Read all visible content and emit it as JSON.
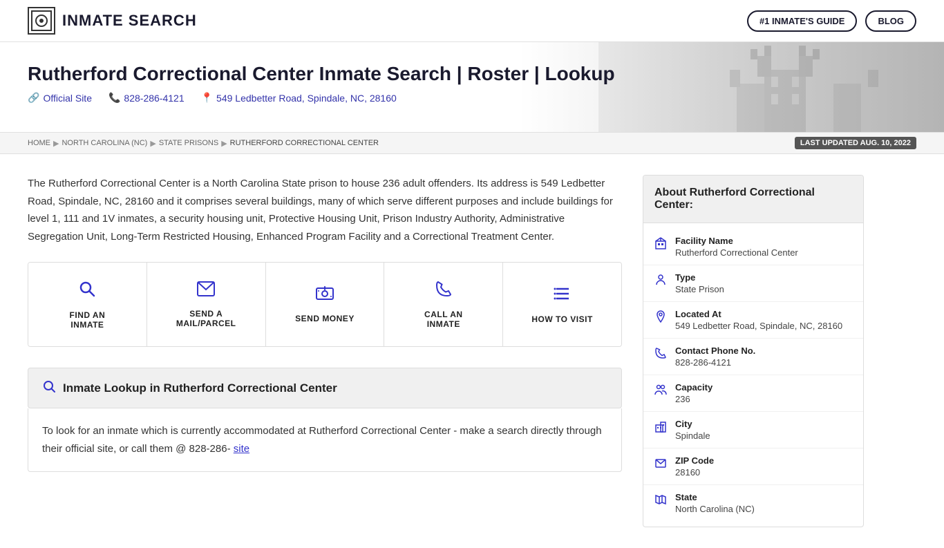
{
  "header": {
    "logo_text": "INMATE SEARCH",
    "nav": {
      "guide_button": "#1 INMATE'S GUIDE",
      "blog_button": "BLOG"
    }
  },
  "hero": {
    "title": "Rutherford Correctional Center Inmate Search | Roster | Lookup",
    "official_site_label": "Official Site",
    "phone": "828-286-4121",
    "address": "549 Ledbetter Road, Spindale, NC, 28160"
  },
  "breadcrumb": {
    "home": "HOME",
    "nc": "NORTH CAROLINA (NC)",
    "state_prisons": "STATE PRISONS",
    "current": "RUTHERFORD CORRECTIONAL CENTER",
    "last_updated": "LAST UPDATED AUG. 10, 2022"
  },
  "description": "The Rutherford Correctional Center is a North Carolina State prison to house 236 adult offenders. Its address is 549 Ledbetter Road, Spindale, NC, 28160 and it comprises several buildings, many of which serve different purposes and include buildings for level 1, 111 and 1V inmates, a security housing unit, Protective Housing Unit, Prison Industry Authority, Administrative Segregation Unit, Long-Term Restricted Housing, Enhanced Program Facility and a Correctional Treatment Center.",
  "action_cards": [
    {
      "id": "find-inmate",
      "label": "FIND AN\nINMATE",
      "icon": "search"
    },
    {
      "id": "send-mail",
      "label": "SEND A\nMAIL/PARCEL",
      "icon": "mail"
    },
    {
      "id": "send-money",
      "label": "SEND MONEY",
      "icon": "money"
    },
    {
      "id": "call-inmate",
      "label": "CALL AN\nINMATE",
      "icon": "phone"
    },
    {
      "id": "how-to-visit",
      "label": "HOW TO VISIT",
      "icon": "list"
    }
  ],
  "lookup": {
    "header": "Inmate Lookup in Rutherford Correctional Center",
    "body": "To look for an inmate which is currently accommodated at Rutherford Correctional Center - make a search directly through their official site, or call them @ 828-286-"
  },
  "sidebar": {
    "title": "About Rutherford Correctional Center:",
    "rows": [
      {
        "icon": "building",
        "label": "Facility Name",
        "value": "Rutherford Correctional Center"
      },
      {
        "icon": "person",
        "label": "Type",
        "value": "State Prison"
      },
      {
        "icon": "location",
        "label": "Located At",
        "value": "549 Ledbetter Road, Spindale, NC, 28160"
      },
      {
        "icon": "phone",
        "label": "Contact Phone No.",
        "value": "828-286-4121"
      },
      {
        "icon": "people",
        "label": "Capacity",
        "value": "236"
      },
      {
        "icon": "building2",
        "label": "City",
        "value": "Spindale"
      },
      {
        "icon": "mail",
        "label": "ZIP Code",
        "value": "28160"
      },
      {
        "icon": "map",
        "label": "State",
        "value": "North Carolina (NC)"
      }
    ]
  }
}
